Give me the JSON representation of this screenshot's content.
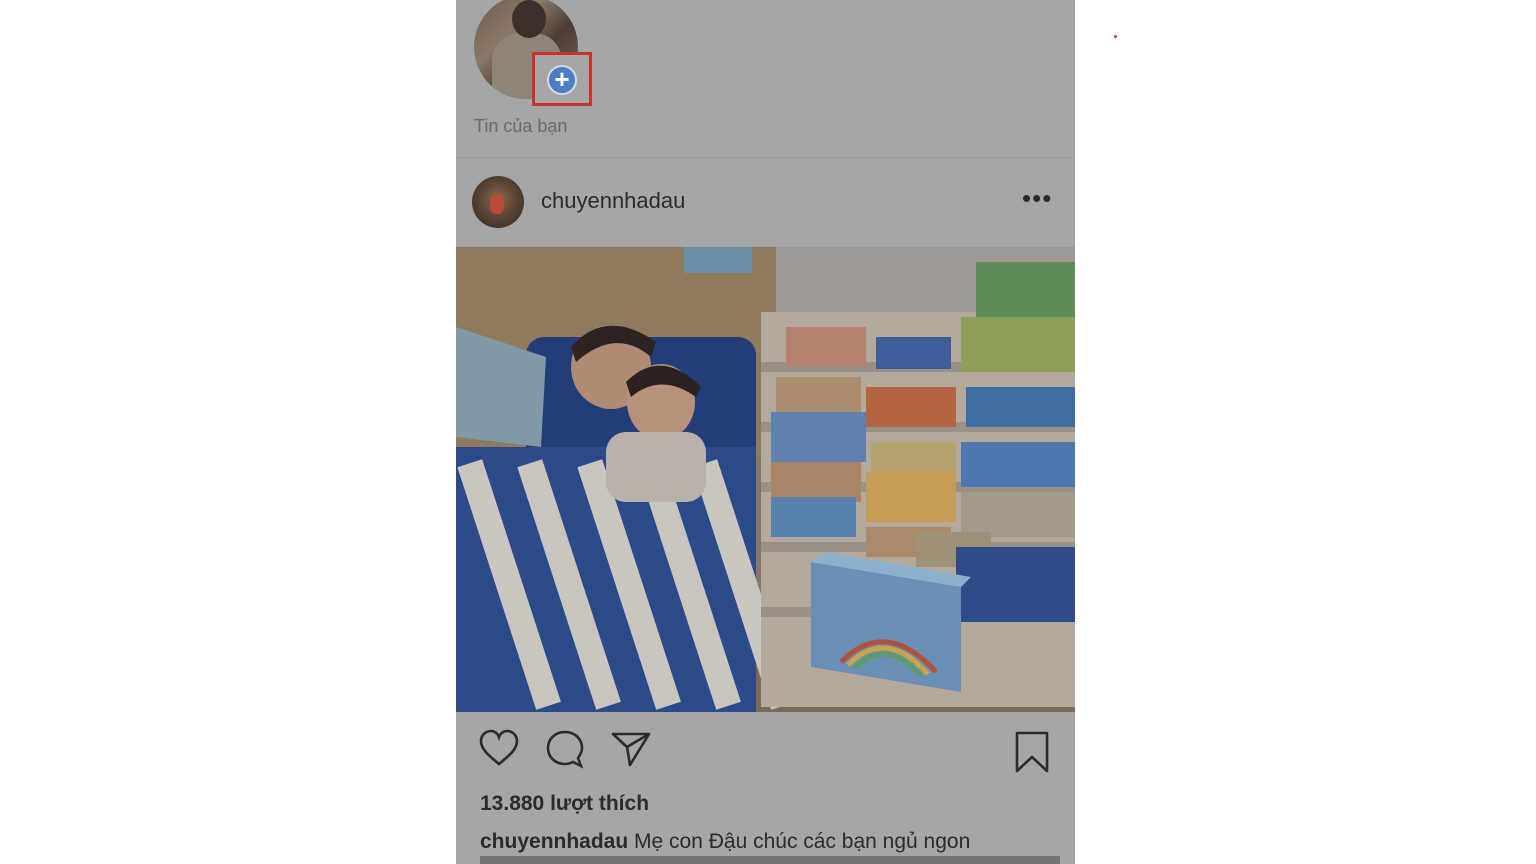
{
  "story": {
    "label": "Tin của bạn",
    "add_icon": "plus-circle-icon"
  },
  "post": {
    "username": "chuyennhadau",
    "more_icon": "more-horizontal-icon",
    "likes": "13.880 lượt thích",
    "caption_user": "chuyennhadau",
    "caption_text": " Mẹ con Đậu chúc các bạn ngủ ngon"
  },
  "actions": {
    "like_icon": "heart-icon",
    "comment_icon": "comment-icon",
    "share_icon": "send-icon",
    "save_icon": "bookmark-icon"
  },
  "colors": {
    "overlay": "#a6a6a6",
    "highlight": "#c9312c",
    "add_button": "#4a7fc7"
  }
}
